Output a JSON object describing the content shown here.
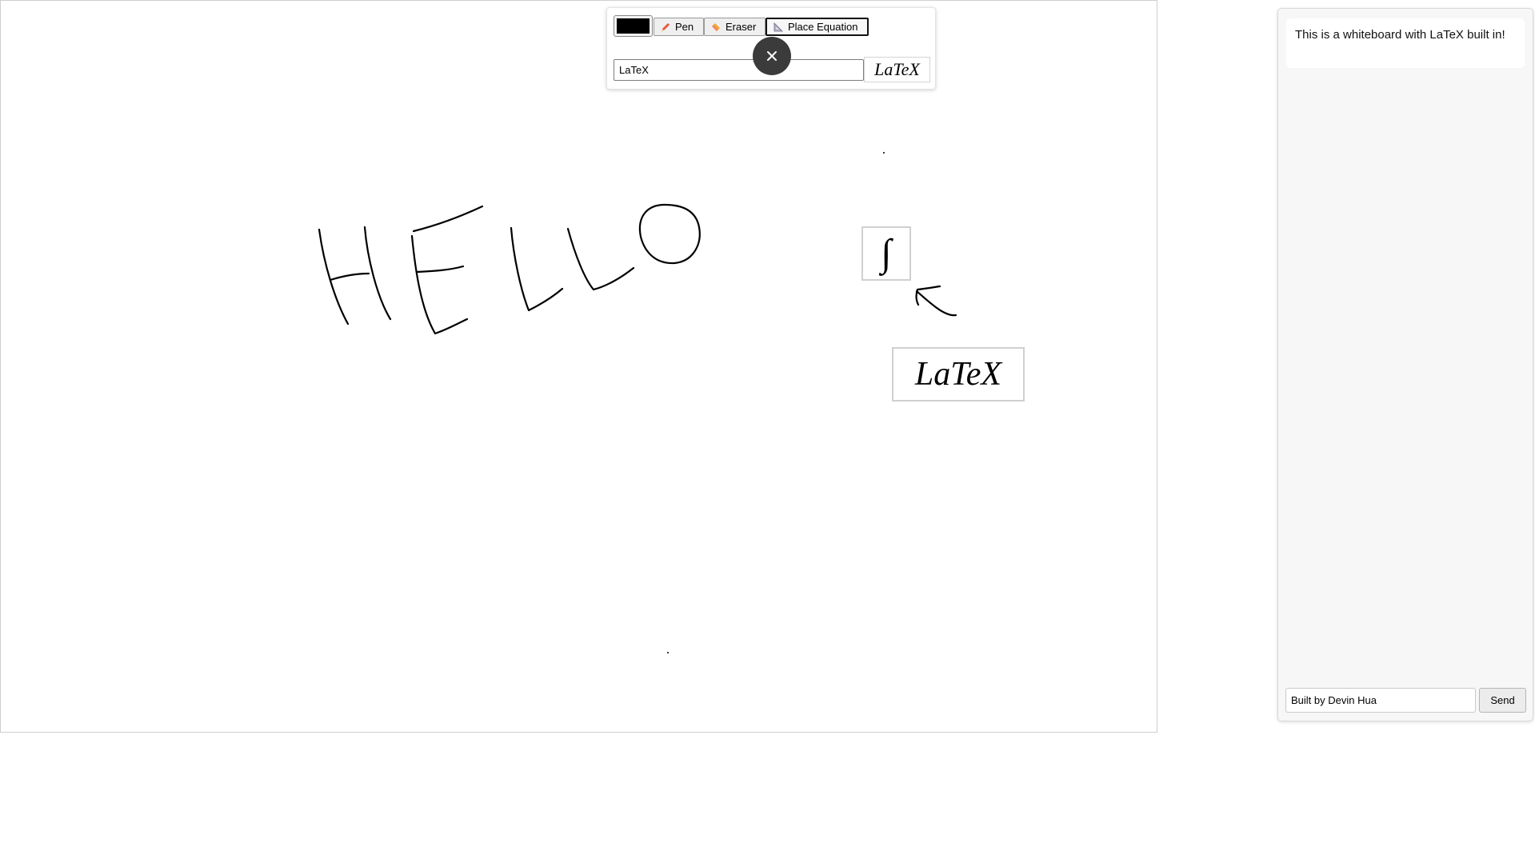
{
  "toolbar": {
    "color_value": "#000000",
    "pen_label": "Pen",
    "eraser_label": "Eraser",
    "equation_label": "Place Equation",
    "equation_input_value": "LaTeX",
    "equation_preview": "LaTeX",
    "pen_icon": "pencil-icon",
    "eraser_icon": "eraser-icon",
    "equation_icon": "set-square-icon",
    "active_tool": "Place Equation"
  },
  "close_icon": "close-icon",
  "board": {
    "drawing_text": "HELLO",
    "equations": [
      {
        "latex": "\\int",
        "rendered": "∫"
      },
      {
        "latex": "LaTeX",
        "rendered": "LaTeX"
      }
    ]
  },
  "chat": {
    "message": "This is a whiteboard with LaTeX built in!",
    "input_value": "Built by Devin Hua",
    "send_label": "Send"
  }
}
